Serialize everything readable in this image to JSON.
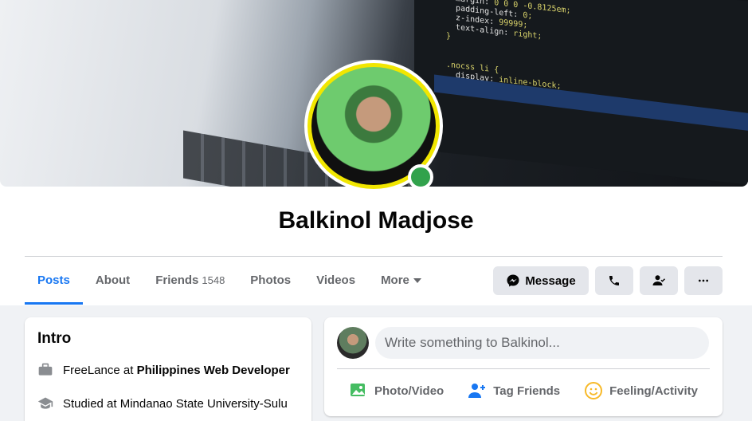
{
  "profile": {
    "name": "Balkinol Madjose",
    "online": true
  },
  "tabs": [
    {
      "label": "Posts",
      "active": true
    },
    {
      "label": "About"
    },
    {
      "label": "Friends",
      "count": "1548"
    },
    {
      "label": "Photos"
    },
    {
      "label": "Videos"
    },
    {
      "label": "More"
    }
  ],
  "actions": {
    "message_label": "Message",
    "call_icon": "phone-icon",
    "friend_icon": "friend-status-icon",
    "more_icon": "ellipsis-icon"
  },
  "intro": {
    "title": "Intro",
    "work_prefix": "FreeLance at ",
    "work_place": "Philippines Web Developer",
    "study_text": "Studied at Mindanao State University-Sulu"
  },
  "composer": {
    "placeholder": "Write something to Balkinol...",
    "options": [
      {
        "label": "Photo/Video",
        "icon": "photo-icon",
        "color": "#45bd62"
      },
      {
        "label": "Tag Friends",
        "icon": "tag-friends-icon",
        "color": "#1877f2"
      },
      {
        "label": "Feeling/Activity",
        "icon": "feeling-icon",
        "color": "#f7b928"
      }
    ]
  },
  "colors": {
    "accent": "#1877f2",
    "online": "#31a24c",
    "avatar_ring": "#f1e600"
  }
}
